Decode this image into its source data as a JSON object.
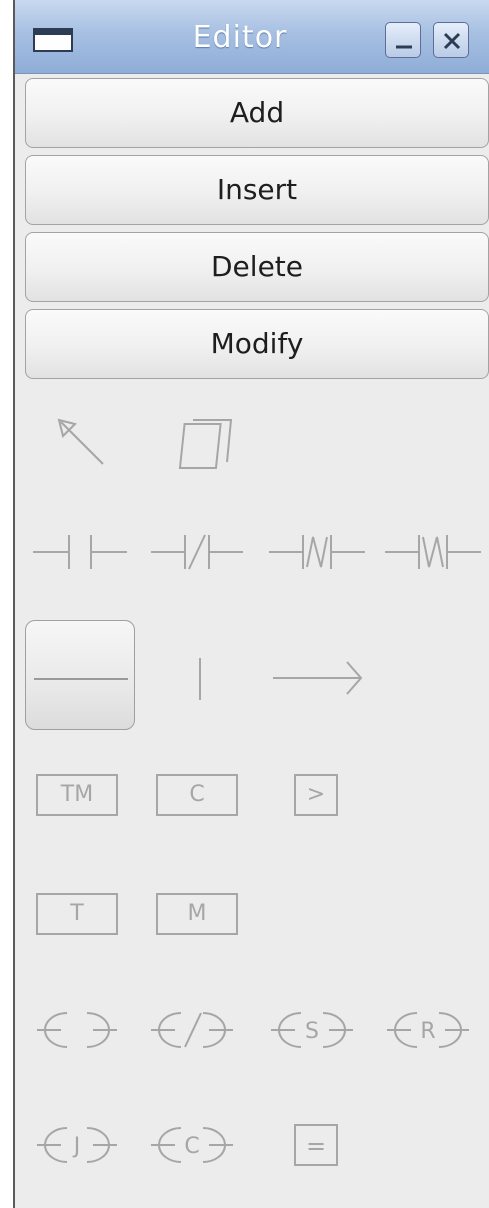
{
  "window": {
    "title": "Editor",
    "icons": [
      "window-menu-icon",
      "minimize-icon",
      "close-icon"
    ]
  },
  "actions": {
    "add": "Add",
    "insert": "Insert",
    "delete": "Delete",
    "modify": "Modify"
  },
  "palette": {
    "timer_label": "TM",
    "counter_label": "C",
    "compare_label": ">",
    "t_label": "T",
    "m_label": "M",
    "coil_set_label": "S",
    "coil_reset_label": "R",
    "coil_jump_label": "J",
    "coil_call_label": "C",
    "operate_label": "=",
    "selected_tool": "horizontal-wire-tool"
  },
  "colors": {
    "titlebar": "#a7c0e2",
    "panel": "#ececec",
    "icon_stroke": "#a6a6a6"
  }
}
